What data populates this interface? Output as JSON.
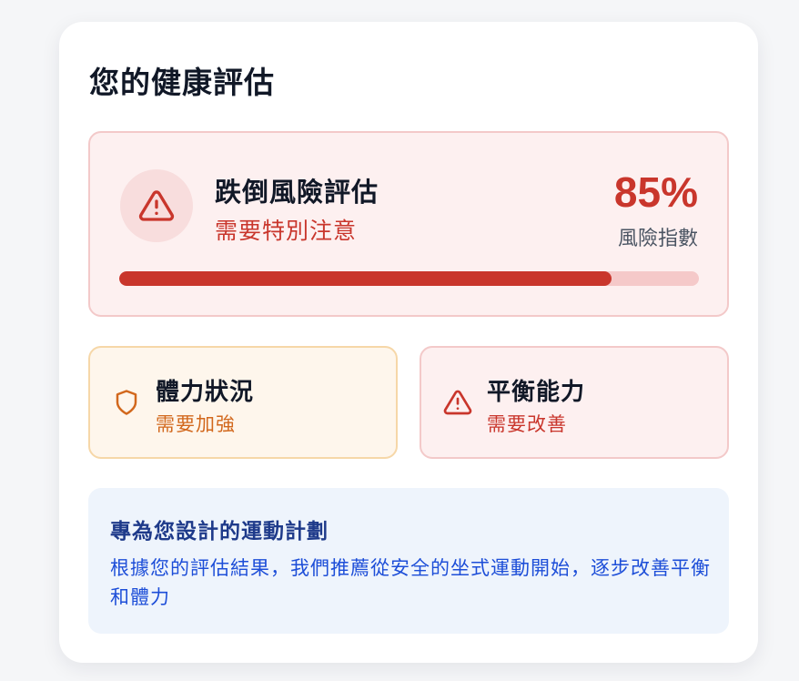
{
  "assessment": {
    "title": "您的健康評估",
    "fall_risk": {
      "icon": "warning-triangle-icon",
      "title": "跌倒風險評估",
      "subtitle": "需要特別注意",
      "value_text": "85%",
      "value_fraction": 0.85,
      "value_label": "風險指數",
      "accent_color": "#c9362c"
    },
    "fitness": {
      "icon": "shield-icon",
      "title": "體力狀況",
      "status": "需要加強",
      "accent_color": "#d2681d"
    },
    "balance": {
      "icon": "warning-triangle-icon",
      "title": "平衡能力",
      "status": "需要改善",
      "accent_color": "#c9362c"
    },
    "plan": {
      "title": "專為您設計的運動計劃",
      "description": "根據您的評估結果，我們推薦從安全的坐式運動開始，逐步改善平衡和體力"
    }
  }
}
